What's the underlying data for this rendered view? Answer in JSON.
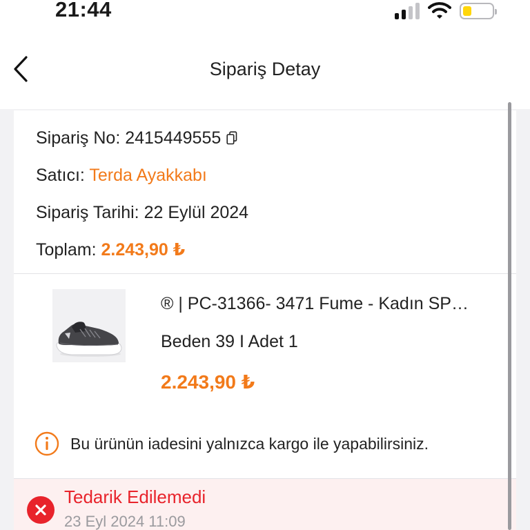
{
  "status_bar": {
    "time": "21:44",
    "battery_level": 0.3,
    "battery_color": "#ffd60a",
    "icons": [
      "cellular-signal-icon",
      "wifi-icon",
      "battery-icon"
    ]
  },
  "nav": {
    "title": "Sipariş Detay",
    "back_icon": "chevron-left-icon"
  },
  "order": {
    "number_label": "Sipariş No:",
    "number": "2415449555",
    "seller_label": "Satıcı:",
    "seller": "Terda Ayakkabı",
    "date_label": "Sipariş Tarihi:",
    "date": "22 Eylül 2024",
    "total_label": "Toplam:",
    "total": "2.243,90 ₺"
  },
  "product": {
    "name": "® | PC-31366- 3471 Fume - Kadın SP…",
    "variant": "Beden 39 I Adet 1",
    "price": "2.243,90 ₺",
    "image_icon": "sneaker-image"
  },
  "notice": {
    "icon": "info-icon",
    "text": "Bu ürünün iadesini yalnızca kargo ile yapabilirsiniz."
  },
  "delivery_status": {
    "icon": "error-x-icon",
    "title": "Tedarik Edilemedi",
    "date": "23 Eyl 2024 11:09"
  },
  "colors": {
    "accent": "#f27a1a",
    "error": "#e8232b",
    "error_bg": "#fdf0f0"
  }
}
